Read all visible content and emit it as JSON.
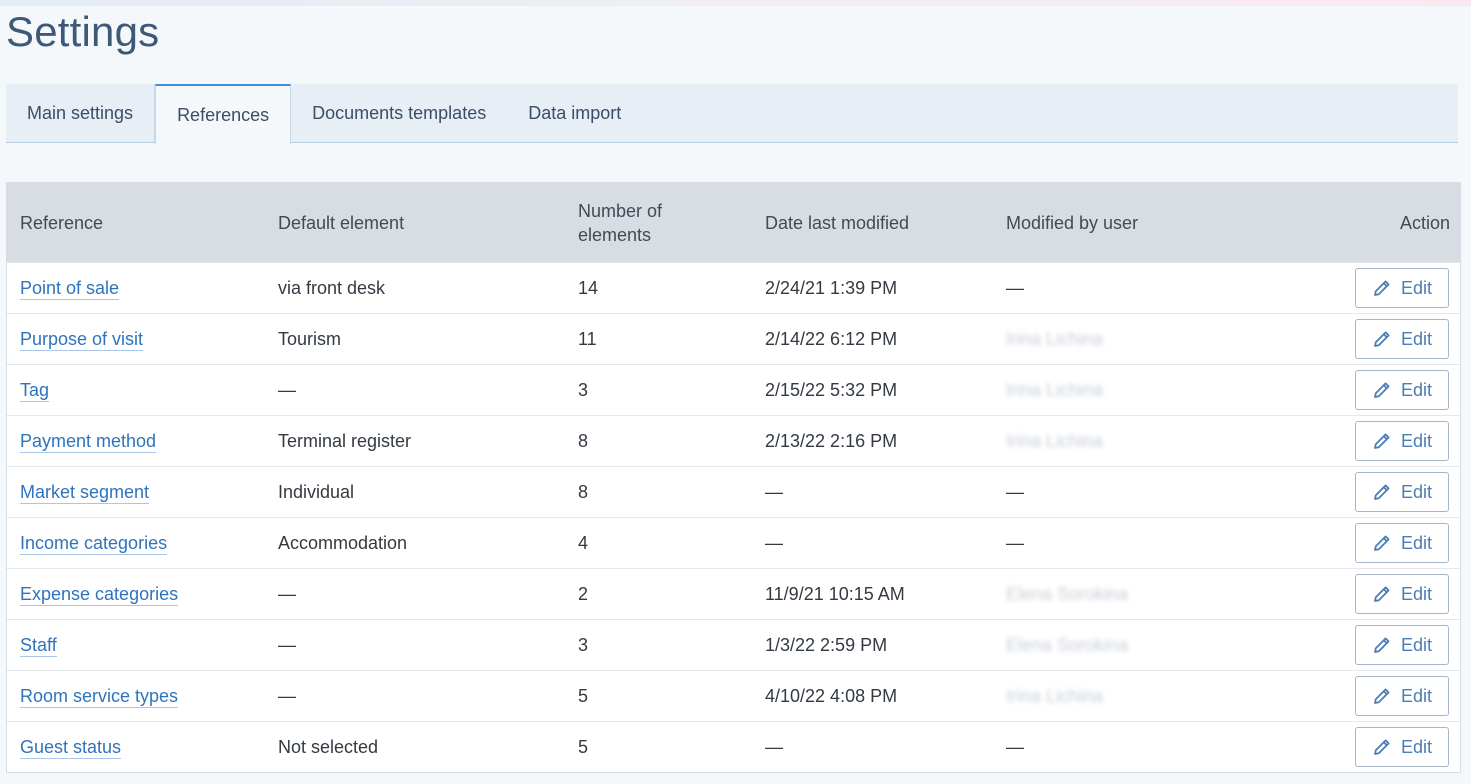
{
  "page": {
    "title": "Settings"
  },
  "tabs": [
    {
      "label": "Main settings"
    },
    {
      "label": "References"
    },
    {
      "label": "Documents templates"
    },
    {
      "label": "Data import"
    }
  ],
  "table": {
    "headers": {
      "reference": "Reference",
      "default_element": "Default element",
      "number_of_elements": "Number of elements",
      "date_last_modified": "Date last modified",
      "modified_by_user": "Modified by user",
      "action": "Action"
    },
    "edit_label": "Edit",
    "edit_icon": "pencil-icon",
    "rows": [
      {
        "reference": "Point of sale",
        "default_element": "via front desk",
        "count": "14",
        "date": "2/24/21 1:39 PM",
        "user": "—",
        "user_blurred": false
      },
      {
        "reference": "Purpose of visit",
        "default_element": "Tourism",
        "count": "11",
        "date": "2/14/22 6:12 PM",
        "user": "Irina Lichina",
        "user_blurred": true
      },
      {
        "reference": "Tag",
        "default_element": "—",
        "count": "3",
        "date": "2/15/22 5:32 PM",
        "user": "Irina Lichina",
        "user_blurred": true
      },
      {
        "reference": "Payment method",
        "default_element": "Terminal register",
        "count": "8",
        "date": "2/13/22 2:16 PM",
        "user": "Irina Lichina",
        "user_blurred": true
      },
      {
        "reference": "Market segment",
        "default_element": "Individual",
        "count": "8",
        "date": "—",
        "user": "—",
        "user_blurred": false
      },
      {
        "reference": "Income categories",
        "default_element": "Accommodation",
        "count": "4",
        "date": "—",
        "user": "—",
        "user_blurred": false
      },
      {
        "reference": "Expense categories",
        "default_element": "—",
        "count": "2",
        "date": "11/9/21 10:15 AM",
        "user": "Elena Sorokina",
        "user_blurred": true
      },
      {
        "reference": "Staff",
        "default_element": "—",
        "count": "3",
        "date": "1/3/22 2:59 PM",
        "user": "Elena Sorokina",
        "user_blurred": true
      },
      {
        "reference": "Room service types",
        "default_element": "—",
        "count": "5",
        "date": "4/10/22 4:08 PM",
        "user": "Irina Lichina",
        "user_blurred": true
      },
      {
        "reference": "Guest status",
        "default_element": "Not selected",
        "count": "5",
        "date": "—",
        "user": "—",
        "user_blurred": false
      }
    ]
  }
}
